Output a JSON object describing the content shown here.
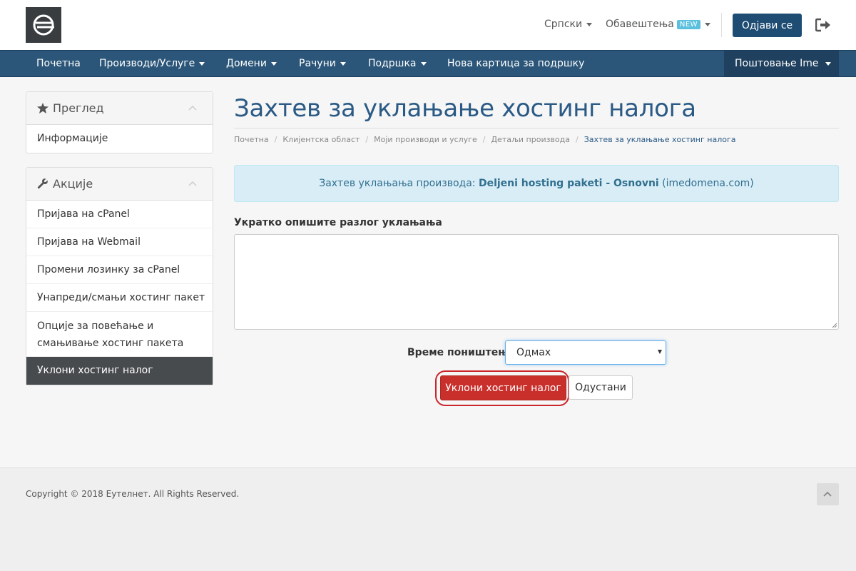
{
  "header": {
    "language": "Српски",
    "notifications": "Обавештења",
    "notifications_badge": "NEW",
    "logout_label": "Одјави се"
  },
  "nav": {
    "items": [
      {
        "label": "Почетна"
      },
      {
        "label": "Производи/Услуге"
      },
      {
        "label": "Домени"
      },
      {
        "label": "Рачуни"
      },
      {
        "label": "Подршка"
      },
      {
        "label": "Нова картица за подршку"
      }
    ],
    "account": "Поштовање Ime"
  },
  "sidebar": {
    "overview": {
      "title": "Преглед",
      "items": [
        {
          "label": "Информације"
        }
      ]
    },
    "actions": {
      "title": "Акције",
      "items": [
        {
          "label": "Пријава на cPanel"
        },
        {
          "label": "Пријава на Webmail"
        },
        {
          "label": "Промени лозинку за cPanel"
        },
        {
          "label": "Унапреди/смањи хостинг пакет"
        },
        {
          "label": "Опције за повећање и смањивање хостинг пакета"
        },
        {
          "label": "Уклони хостинг налог"
        }
      ]
    }
  },
  "main": {
    "title": "Захтев за уклањање хостинг налога",
    "breadcrumb": [
      "Почетна",
      "Клијентска област",
      "Моји производи и услуге",
      "Детаљи производа",
      "Захтев за уклањање хостинг налога"
    ],
    "alert": {
      "prefix": "Захтев уклањања производа: ",
      "product": "Deljeni hosting paketi - Osnovni",
      "domain": " (imedomena.com)"
    },
    "reason_label": "Укратко опишите разлог уклањања",
    "reason_value": "",
    "time_label": "Време поништења",
    "time_value": "Одмах",
    "remove_label": "Уклони хостинг налог",
    "cancel_label": "Одустани"
  },
  "footer": {
    "copyright": "Copyright © 2018 Еутелнет. All Rights Reserved."
  },
  "colors": {
    "navbar": "#2b5679",
    "primary": "#1e4c73",
    "danger": "#c9302c",
    "alert_bg": "#d9edf7"
  }
}
